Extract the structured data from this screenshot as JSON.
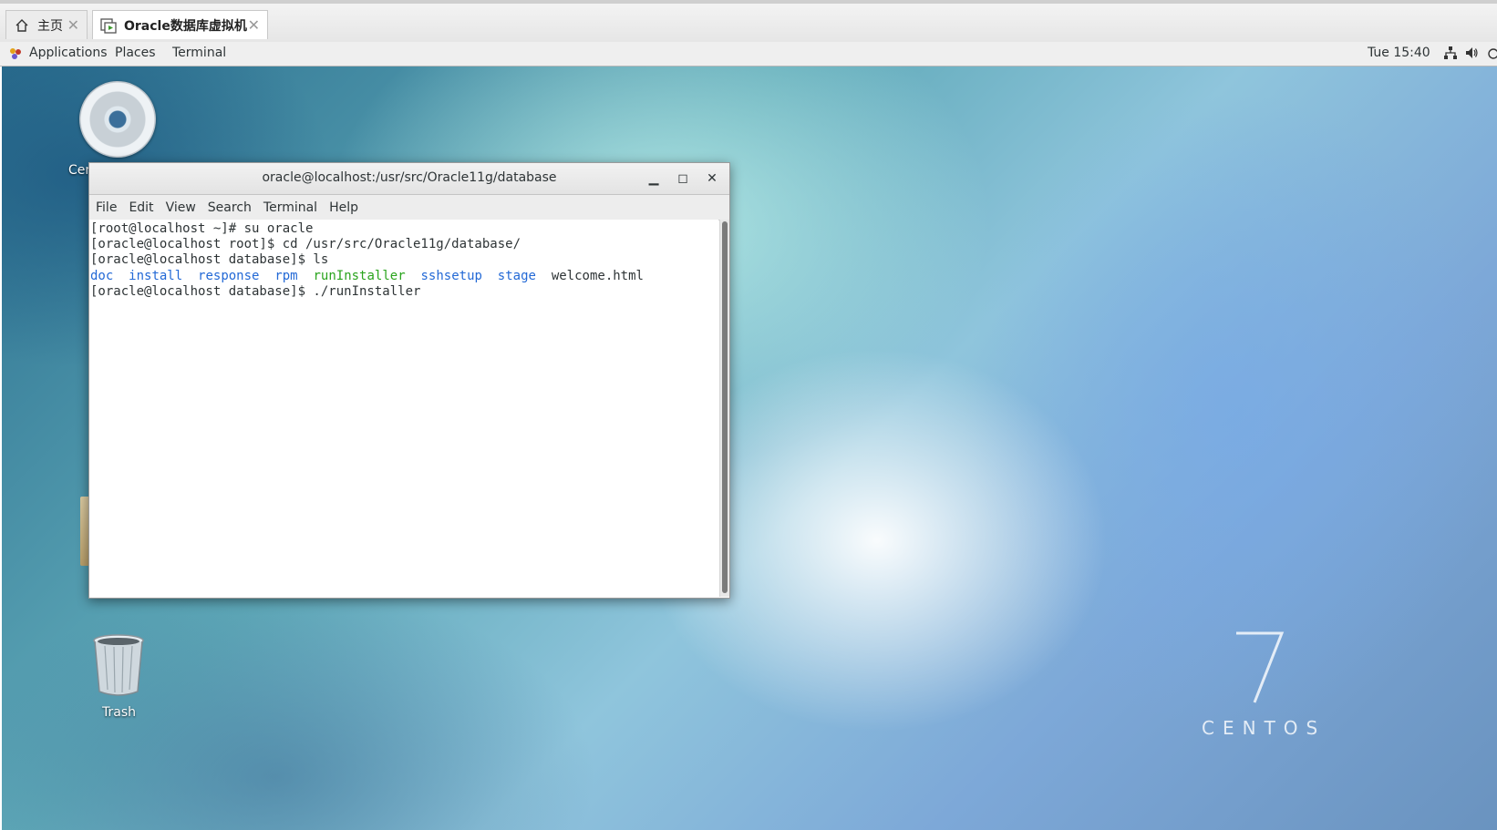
{
  "host_tabs": [
    {
      "label": "主页",
      "icon": "home-icon"
    },
    {
      "label": "Oracle数据库虚拟机",
      "icon": "vm-icon"
    }
  ],
  "topbar": {
    "applications": "Applications",
    "places": "Places",
    "terminal": "Terminal",
    "clock": "Tue 15:40",
    "icons": [
      "network-icon",
      "volume-icon",
      "power-icon"
    ]
  },
  "desktop": {
    "disc_label": "Cen",
    "trash_label": "Trash",
    "logo_number": "7",
    "logo_text": "CENTOS"
  },
  "terminal": {
    "title": "oracle@localhost:/usr/src/Oracle11g/database",
    "menu": [
      "File",
      "Edit",
      "View",
      "Search",
      "Terminal",
      "Help"
    ],
    "lines": [
      "[root@localhost ~]# su oracle",
      "[oracle@localhost root]$ cd /usr/src/Oracle11g/database/",
      "[oracle@localhost database]$ ls"
    ],
    "ls_output": {
      "doc": "doc",
      "install": "install",
      "response": "response",
      "rpm": "rpm",
      "runInstaller": "runInstaller",
      "sshsetup": "sshsetup",
      "stage": "stage",
      "welcome": "welcome.html"
    },
    "last_line": "[oracle@localhost database]$ ./runInstaller"
  },
  "colors": {
    "dir": "#2369d6",
    "executable": "#2aa41d"
  }
}
